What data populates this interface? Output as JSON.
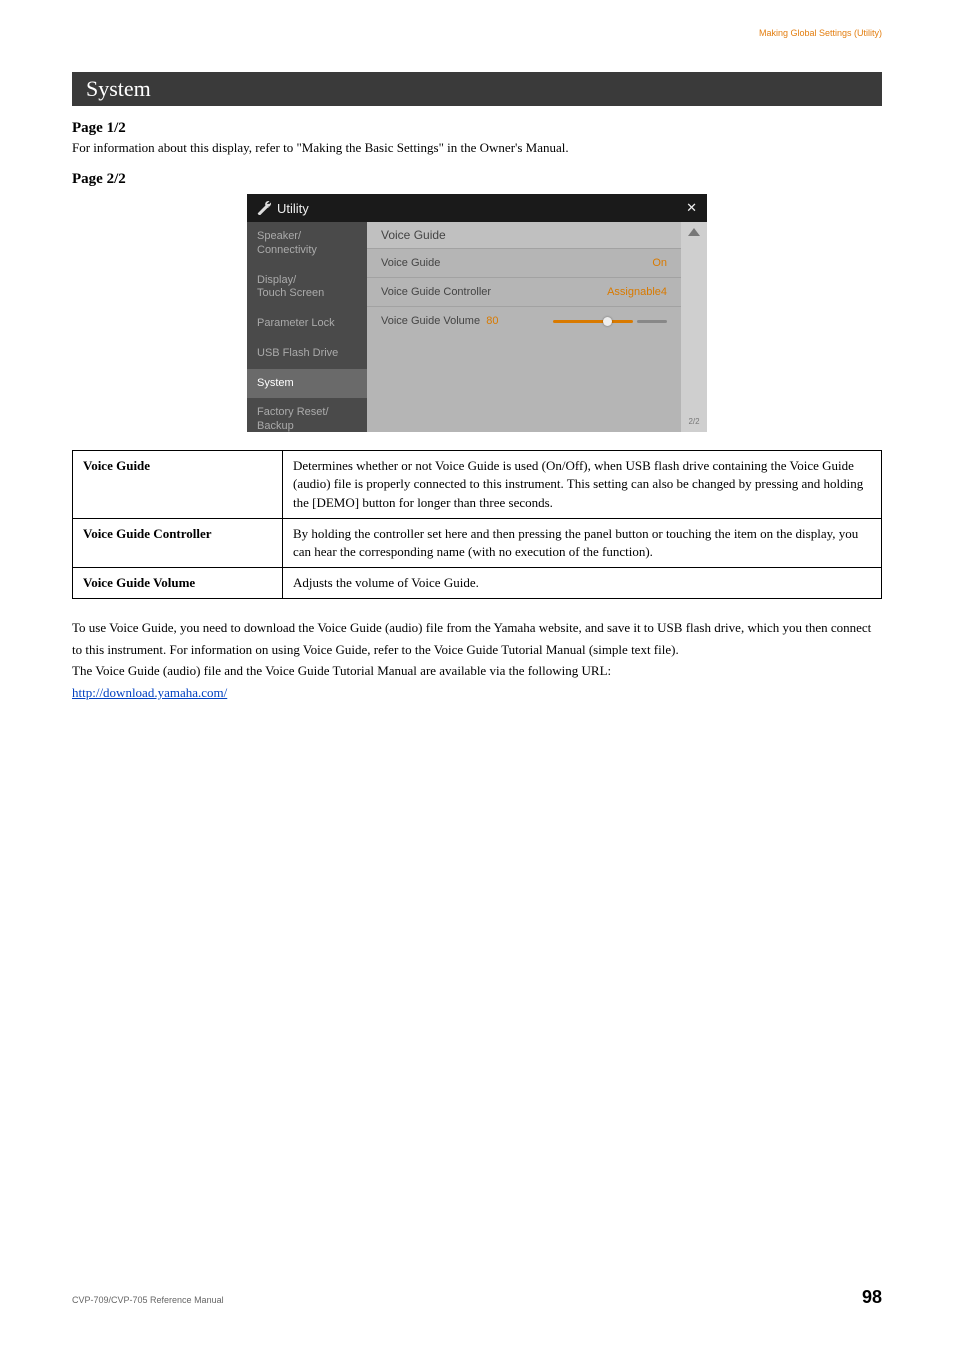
{
  "header_label": "Making Global Settings (Utility)",
  "section_title": "System",
  "page1": {
    "heading": "Page 1/2",
    "text": "For information about this display, refer to \"Making the Basic Settings\" in the Owner's Manual."
  },
  "page2_heading": "Page 2/2",
  "screenshot": {
    "title": "Utility",
    "close": "✕",
    "side": [
      "Speaker/\nConnectivity",
      "Display/\nTouch Screen",
      "Parameter Lock",
      "USB Flash Drive",
      "System",
      "Factory Reset/\nBackup"
    ],
    "active_index": 4,
    "section_label": "Voice Guide",
    "rows": [
      {
        "label": "Voice Guide",
        "value": "On"
      },
      {
        "label": "Voice Guide Controller",
        "value": "Assignable4"
      },
      {
        "label": "Voice Guide Volume",
        "num": "80"
      }
    ],
    "page_ind": "2/2"
  },
  "table": [
    {
      "label": "Voice Guide",
      "desc": "Determines whether or not Voice Guide is used (On/Off), when USB flash drive containing the Voice Guide (audio) file is properly connected to this instrument. This setting can also be changed by pressing and holding the [DEMO] button for longer than three seconds."
    },
    {
      "label": "Voice Guide Controller",
      "desc": "By holding the controller set here and then pressing the panel button or touching the item on the display, you can hear the corresponding name (with no execution of the function)."
    },
    {
      "label": "Voice Guide Volume",
      "desc": "Adjusts the volume of Voice Guide."
    }
  ],
  "body": {
    "p1": "To use Voice Guide, you need to download the Voice Guide (audio) file from the Yamaha website, and save it to USB flash drive, which you then connect to this instrument. For information on using Voice Guide, refer to the Voice Guide Tutorial Manual (simple text file).",
    "p2": "The Voice Guide (audio) file and the Voice Guide Tutorial Manual are available via the following URL:",
    "link": "http://download.yamaha.com/"
  },
  "footer": {
    "left": "CVP-709/CVP-705 Reference Manual",
    "right": "98"
  }
}
